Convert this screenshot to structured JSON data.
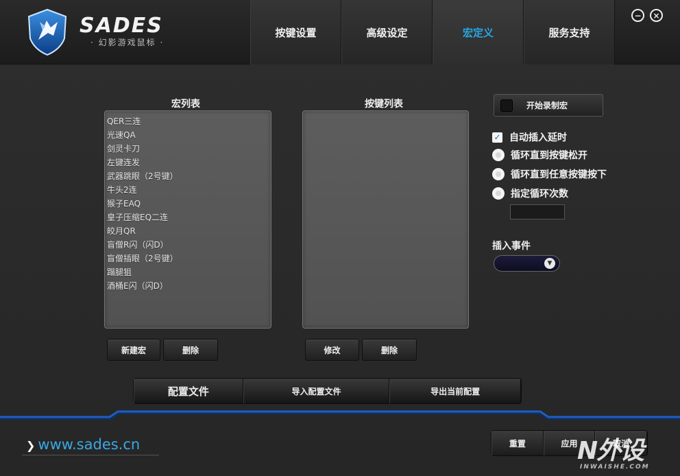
{
  "header": {
    "brand": "SADES",
    "brand_sub": "· 幻影游戏鼠标 ·",
    "tabs": [
      {
        "label": "按键设置",
        "active": false
      },
      {
        "label": "高级设定",
        "active": false
      },
      {
        "label": "宏定义",
        "active": true
      },
      {
        "label": "服务支持",
        "active": false
      }
    ],
    "minimize_glyph": "−",
    "close_glyph": "×"
  },
  "macro_list": {
    "title": "宏列表",
    "items": [
      "QER三连",
      "光速QA",
      "剑灵卡刀",
      "左键连发",
      "武器跳眼（2号键）",
      "牛头2连",
      "猴子EAQ",
      "皇子压缩EQ二连",
      "皎月QR",
      "盲僧R闪（闪D）",
      "盲僧插眼（2号键）",
      "蹋腿狙",
      "酒桶E闪（闪D）"
    ],
    "new_label": "新建宏",
    "delete_label": "删除"
  },
  "key_list": {
    "title": "按键列表",
    "edit_label": "修改",
    "delete_label": "删除"
  },
  "options": {
    "record_label": "开始录制宏",
    "auto_delay_label": "自动插入延时",
    "auto_delay_checked": true,
    "loop_release_label": "循环直到按键松开",
    "loop_any_label": "循环直到任意按键按下",
    "loop_count_label": "指定循环次数",
    "loop_count_value": "",
    "insert_event_label": "插入事件",
    "insert_event_value": ""
  },
  "config": {
    "title": "配置文件",
    "import_label": "导入配置文件",
    "export_label": "导出当前配置"
  },
  "footer": {
    "website": "www.sades.cn",
    "reset_label": "重置",
    "apply_label": "应用",
    "cancel_label": "取消",
    "watermark": "N外设",
    "watermark_sub": "INWAISHE.COM"
  },
  "colors": {
    "accent": "#27a7e6",
    "footer_glow": "#1d5fc4"
  }
}
